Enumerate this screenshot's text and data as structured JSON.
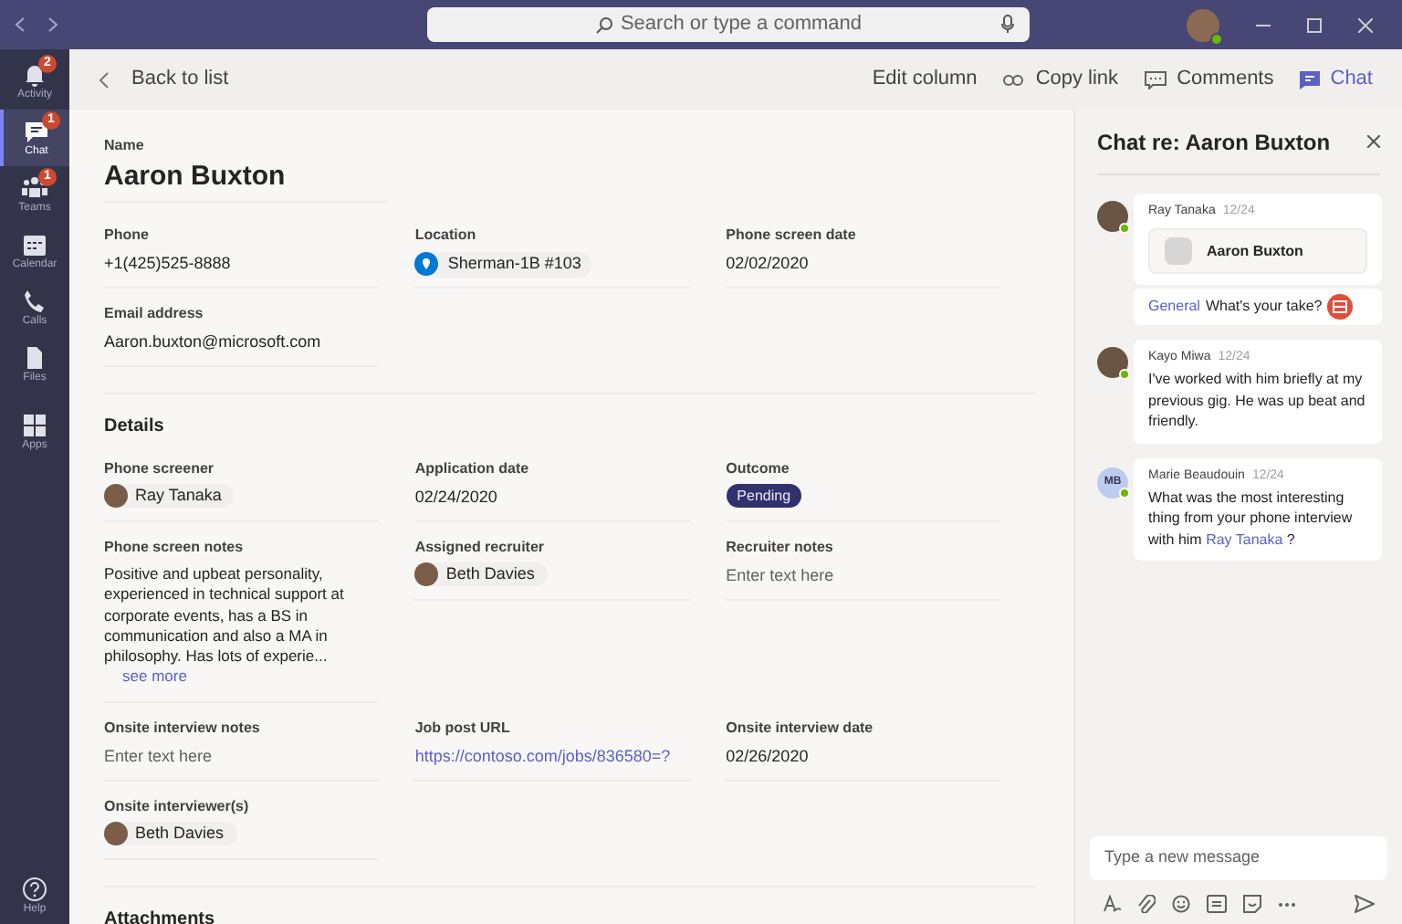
{
  "title_bar": {
    "search": {
      "placeholder": "Search or type a command"
    }
  },
  "rail": [
    {
      "label": "Activity",
      "badge": "2",
      "selected": false
    },
    {
      "label": "Chat",
      "badge": "1",
      "selected": true
    },
    {
      "label": "Teams",
      "badge": "1",
      "selected": false
    },
    {
      "label": "Calendar",
      "selected": false
    },
    {
      "label": "Calls",
      "selected": false
    },
    {
      "label": "Files",
      "selected": false
    },
    {
      "label": "Apps",
      "selected": false
    },
    {
      "label": "Help",
      "selected": false
    }
  ],
  "header": {
    "back": "Back to list",
    "actions": [
      {
        "label": "Edit column",
        "selected": false
      },
      {
        "label": "Copy link",
        "selected": false
      },
      {
        "label": "Comments",
        "selected": false
      },
      {
        "label": "Chat",
        "selected": true
      }
    ]
  },
  "record": {
    "name_label": "Name",
    "name": "Aaron Buxton",
    "contact_fields": [
      {
        "label": "Phone",
        "kind": "text",
        "value": "+1(425)525-8888"
      },
      {
        "label": "Location",
        "kind": "location",
        "value": "Sherman-1B #103"
      },
      {
        "label": "Phone screen date",
        "kind": "text",
        "value": "02/02/2020"
      },
      {
        "label": "Email address",
        "kind": "text",
        "value": "Aaron.buxton@microsoft.com"
      }
    ],
    "details_title": "Details",
    "detail_fields": [
      {
        "label": "Phone screener",
        "kind": "person",
        "value": "Ray Tanaka"
      },
      {
        "label": "Application date",
        "kind": "text",
        "value": "02/24/2020"
      },
      {
        "label": "Outcome",
        "kind": "status",
        "value": "Pending"
      },
      {
        "label": "Phone screen notes",
        "kind": "note",
        "value": "Positive and upbeat personality, experienced in technical support at corporate events, has a BS in communication and also a MA in philosophy. Has lots of experie...",
        "more": "see more"
      },
      {
        "label": "Assigned recruiter",
        "kind": "person",
        "value": "Beth Davies"
      },
      {
        "label": "Recruiter notes",
        "kind": "empty",
        "placeholder": "Enter text here"
      },
      {
        "label": "Onsite interview notes",
        "kind": "empty",
        "placeholder": "Enter text here"
      },
      {
        "label": "Job post URL",
        "kind": "link",
        "value": "https://contoso.com/jobs/836580=?"
      },
      {
        "label": "Onsite interview date",
        "kind": "text",
        "value": "02/26/2020"
      },
      {
        "label": "Onsite interviewer(s)",
        "kind": "person",
        "value": "Beth Davies"
      }
    ],
    "attachments_title": "Attachments"
  },
  "chat": {
    "title": "Chat re: Aaron Buxton",
    "messages": [
      {
        "author": "Ray Tanaka",
        "time": "12/24",
        "card": "Aaron Buxton",
        "channel": "General",
        "channel_text": "What's your take?"
      },
      {
        "author": "Kayo Miwa",
        "time": "12/24",
        "text": "I've worked with him briefly at my previous gig. He was up beat and friendly."
      },
      {
        "author": "Marie Beaudouin",
        "time": "12/24",
        "initials": "MB",
        "text": "What was the most interesting thing from your phone interview with him",
        "mention": "Ray Tanaka",
        "text_after": "?"
      }
    ],
    "composer": {
      "placeholder": "Type a new message"
    }
  }
}
